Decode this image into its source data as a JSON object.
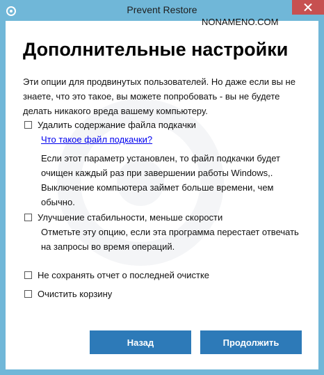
{
  "window": {
    "title": "Prevent Restore",
    "watermark": "NONAMENO.COM",
    "app_icon": "app-logo-icon",
    "close_icon": "close-icon"
  },
  "page": {
    "heading": "Дополнительные настройки",
    "intro": "Эти опции для продвинутых пользователей. Но даже если вы не знаете, что это такое, вы можете попробовать - вы не будете делать никакого вреда вашему компьютеру."
  },
  "options": {
    "pagefile": {
      "label": "Удалить содержание файла подкачки",
      "checked": false,
      "link": "Что такое файл подкачки?",
      "description": "Если этот параметр установлен, то файл подкачки будет очищен каждый раз при завершении работы Windows,. Выключение компьютера займет больше времени, чем обычно."
    },
    "stability": {
      "label": "Улучшение стабильности, меньше скорости",
      "checked": false,
      "description": "Отметьте эту опцию, если эта программа перестает отвечать на запросы во время операций."
    },
    "no_report": {
      "label": "Не сохранять отчет о последней очистке",
      "checked": false
    },
    "recycle": {
      "label": "Очистить корзину",
      "checked": false
    }
  },
  "buttons": {
    "back": "Назад",
    "continue": "Продолжить"
  },
  "colors": {
    "frame": "#70b7d8",
    "close": "#c75050",
    "button": "#2d7ab8",
    "link": "#0000ee"
  }
}
